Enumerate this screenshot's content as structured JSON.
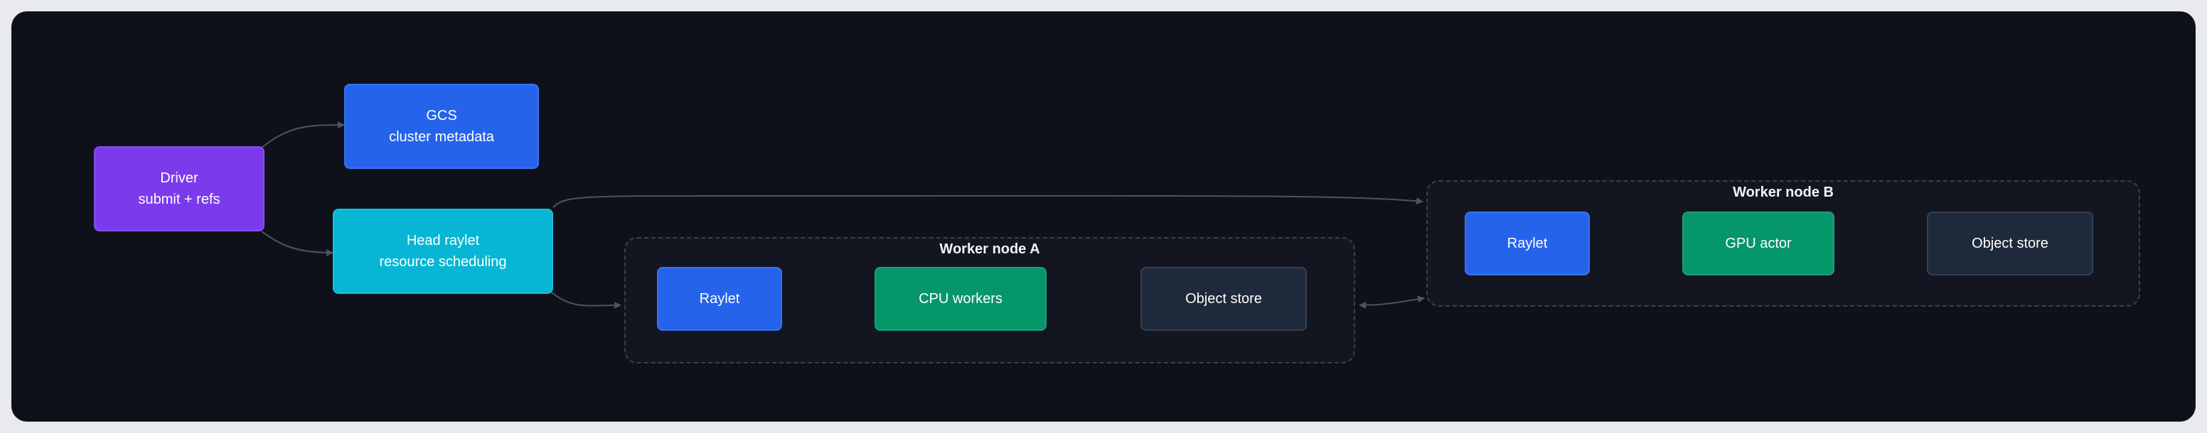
{
  "colors": {
    "driver": "#7c3aed",
    "gcs": "#2563eb",
    "head_raylet": "#06b6d4",
    "raylet": "#2563eb",
    "workers": "#059669",
    "object_store": "#1e293b",
    "edge": "#4b5563",
    "canvas": "#0f111a"
  },
  "nodes": {
    "driver": {
      "line1": "Driver",
      "line2": "submit + refs"
    },
    "gcs": {
      "line1": "GCS",
      "line2": "cluster metadata"
    },
    "head_raylet": {
      "line1": "Head raylet",
      "line2": "resource scheduling"
    }
  },
  "worker_a": {
    "title": "Worker node A",
    "raylet": "Raylet",
    "workers": "CPU workers",
    "object_store": "Object store"
  },
  "worker_b": {
    "title": "Worker node B",
    "raylet": "Raylet",
    "actor": "GPU actor",
    "object_store": "Object store"
  },
  "edges": [
    {
      "from": "Driver",
      "to": "GCS"
    },
    {
      "from": "Driver",
      "to": "Head raylet"
    },
    {
      "from": "Head raylet",
      "to": "Worker node A"
    },
    {
      "from": "Head raylet",
      "to": "Worker node B"
    },
    {
      "from": "Worker node A Raylet",
      "to": "CPU workers"
    },
    {
      "from": "CPU workers",
      "to": "Worker node A Object store"
    },
    {
      "from": "Worker node B Raylet",
      "to": "GPU actor"
    },
    {
      "from": "GPU actor",
      "to": "Worker node B Object store"
    },
    {
      "from": "Worker node A",
      "to": "Worker node B",
      "bidirectional": true
    }
  ]
}
